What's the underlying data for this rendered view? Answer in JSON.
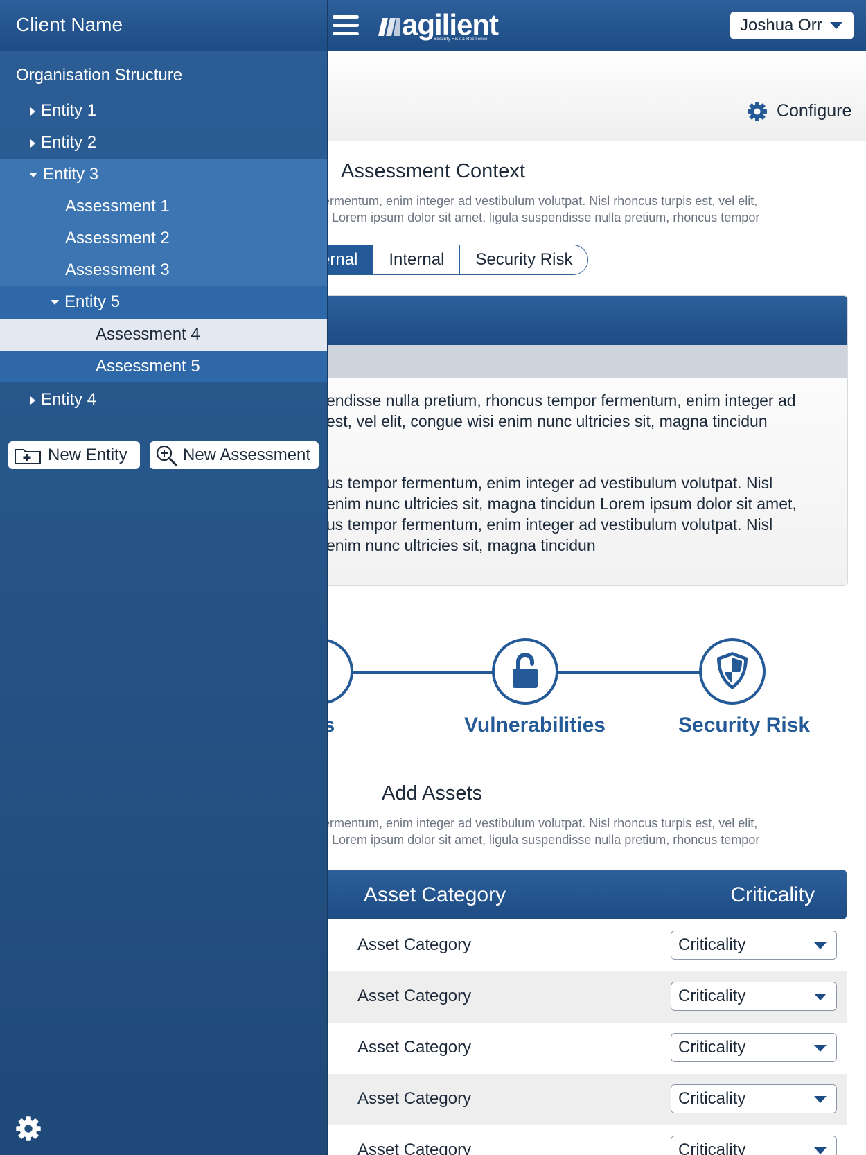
{
  "header": {
    "logo_text": "agilient",
    "logo_tagline": "Security Risk & Resilience",
    "user_name": "Joshua Orr"
  },
  "subheader": {
    "configure_label": "Configure"
  },
  "assessment_context": {
    "title": "Assessment Context",
    "desc_line1": "or fermentum, enim integer ad vestibulum volutpat. Nisl rhoncus turpis est, vel elit,",
    "desc_line2": "idun Lorem ipsum dolor sit amet, ligula suspendisse nulla pretium, rhoncus tempor",
    "tabs": [
      "ernal",
      "Internal",
      "Security Risk"
    ],
    "active_tab": "ernal"
  },
  "panel": {
    "para1_line1": "endisse nulla pretium, rhoncus tempor fermentum, enim integer ad",
    "para1_line2": "est, vel elit, congue wisi enim nunc ultricies sit, magna tincidun",
    "para2_line1": "us tempor fermentum, enim integer ad vestibulum volutpat. Nisl",
    "para2_line2": "enim nunc ultricies sit, magna tincidun Lorem ipsum dolor sit amet,",
    "para2_line3": "us tempor fermentum, enim integer ad vestibulum volutpat. Nisl",
    "para2_line4": "enim nunc ultricies sit, magna tincidun"
  },
  "flow": {
    "steps": [
      {
        "label": "ats",
        "icon": "threats-icon"
      },
      {
        "label": "Vulnerabilities",
        "icon": "padlock-open-icon"
      },
      {
        "label": "Security Risk",
        "icon": "shield-icon"
      }
    ]
  },
  "add_assets": {
    "title": "Add Assets",
    "desc_line1": "or fermentum, enim integer ad vestibulum volutpat. Nisl rhoncus turpis est, vel elit,",
    "desc_line2": "idun Lorem ipsum dolor sit amet, ligula suspendisse nulla pretium, rhoncus tempor"
  },
  "asset_table": {
    "headers": {
      "category": "Asset Category",
      "criticality": "Criticality"
    },
    "rows": [
      {
        "category": "Asset Category",
        "criticality": "Criticality"
      },
      {
        "category": "Asset Category",
        "criticality": "Criticality"
      },
      {
        "category": "Asset Category",
        "criticality": "Criticality"
      },
      {
        "category": "Asset Category",
        "criticality": "Criticality"
      },
      {
        "category": "Asset Category",
        "criticality": "Criticality"
      }
    ]
  },
  "drawer": {
    "client_name": "Client Name",
    "org_title": "Organisation Structure",
    "tree": [
      {
        "label": "Entity 1"
      },
      {
        "label": "Entity 2"
      },
      {
        "label": "Entity 3"
      },
      {
        "label": "Assessment 1"
      },
      {
        "label": "Assessment 2"
      },
      {
        "label": "Assessment 3"
      },
      {
        "label": "Entity 5"
      },
      {
        "label": "Assessment 4"
      },
      {
        "label": "Assessment 5"
      },
      {
        "label": "Entity 4"
      }
    ],
    "new_entity_label": "New Entity",
    "new_assessment_label": "New Assessment"
  },
  "colors": {
    "brand_blue": "#1e4c84",
    "accent_blue": "#245a97",
    "selection_light": "#e4e8f1"
  }
}
